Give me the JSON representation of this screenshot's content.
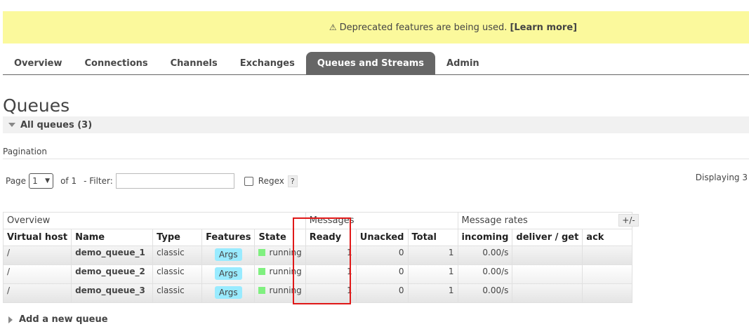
{
  "banner": {
    "warning_icon": "⚠",
    "text": "Deprecated features are being used.",
    "link": "[Learn more]"
  },
  "tabs": [
    {
      "label": "Overview",
      "active": false
    },
    {
      "label": "Connections",
      "active": false
    },
    {
      "label": "Channels",
      "active": false
    },
    {
      "label": "Exchanges",
      "active": false
    },
    {
      "label": "Queues and Streams",
      "active": true
    },
    {
      "label": "Admin",
      "active": false
    }
  ],
  "page_title": "Queues",
  "section": {
    "label": "All queues (3)"
  },
  "pagination": {
    "label": "Pagination",
    "page_label": "Page",
    "page_value": "1",
    "of_label": "of 1",
    "filter_label": "- Filter:",
    "filter_value": "",
    "regex_label": "Regex",
    "help_label": "?",
    "displaying": "Displaying 3"
  },
  "table": {
    "groups": [
      "Overview",
      "Messages",
      "Message rates"
    ],
    "columns": [
      "Virtual host",
      "Name",
      "Type",
      "Features",
      "State",
      "Ready",
      "Unacked",
      "Total",
      "incoming",
      "deliver / get",
      "ack"
    ],
    "rows": [
      {
        "vhost": "/",
        "name": "demo_queue_1",
        "type": "classic",
        "features": "Args",
        "state": "running",
        "ready": "1",
        "unacked": "0",
        "total": "1",
        "incoming": "0.00/s",
        "deliver_get": "",
        "ack": ""
      },
      {
        "vhost": "/",
        "name": "demo_queue_2",
        "type": "classic",
        "features": "Args",
        "state": "running",
        "ready": "1",
        "unacked": "0",
        "total": "1",
        "incoming": "0.00/s",
        "deliver_get": "",
        "ack": ""
      },
      {
        "vhost": "/",
        "name": "demo_queue_3",
        "type": "classic",
        "features": "Args",
        "state": "running",
        "ready": "1",
        "unacked": "0",
        "total": "1",
        "incoming": "0.00/s",
        "deliver_get": "",
        "ack": ""
      }
    ],
    "columns_toggle": "+/-"
  },
  "add_queue": "Add a new queue",
  "colors": {
    "banner": "#fbf99c",
    "active_tab": "#666666",
    "args_badge": "#99ebff",
    "running": "#80f080",
    "highlight": "#e01818"
  }
}
